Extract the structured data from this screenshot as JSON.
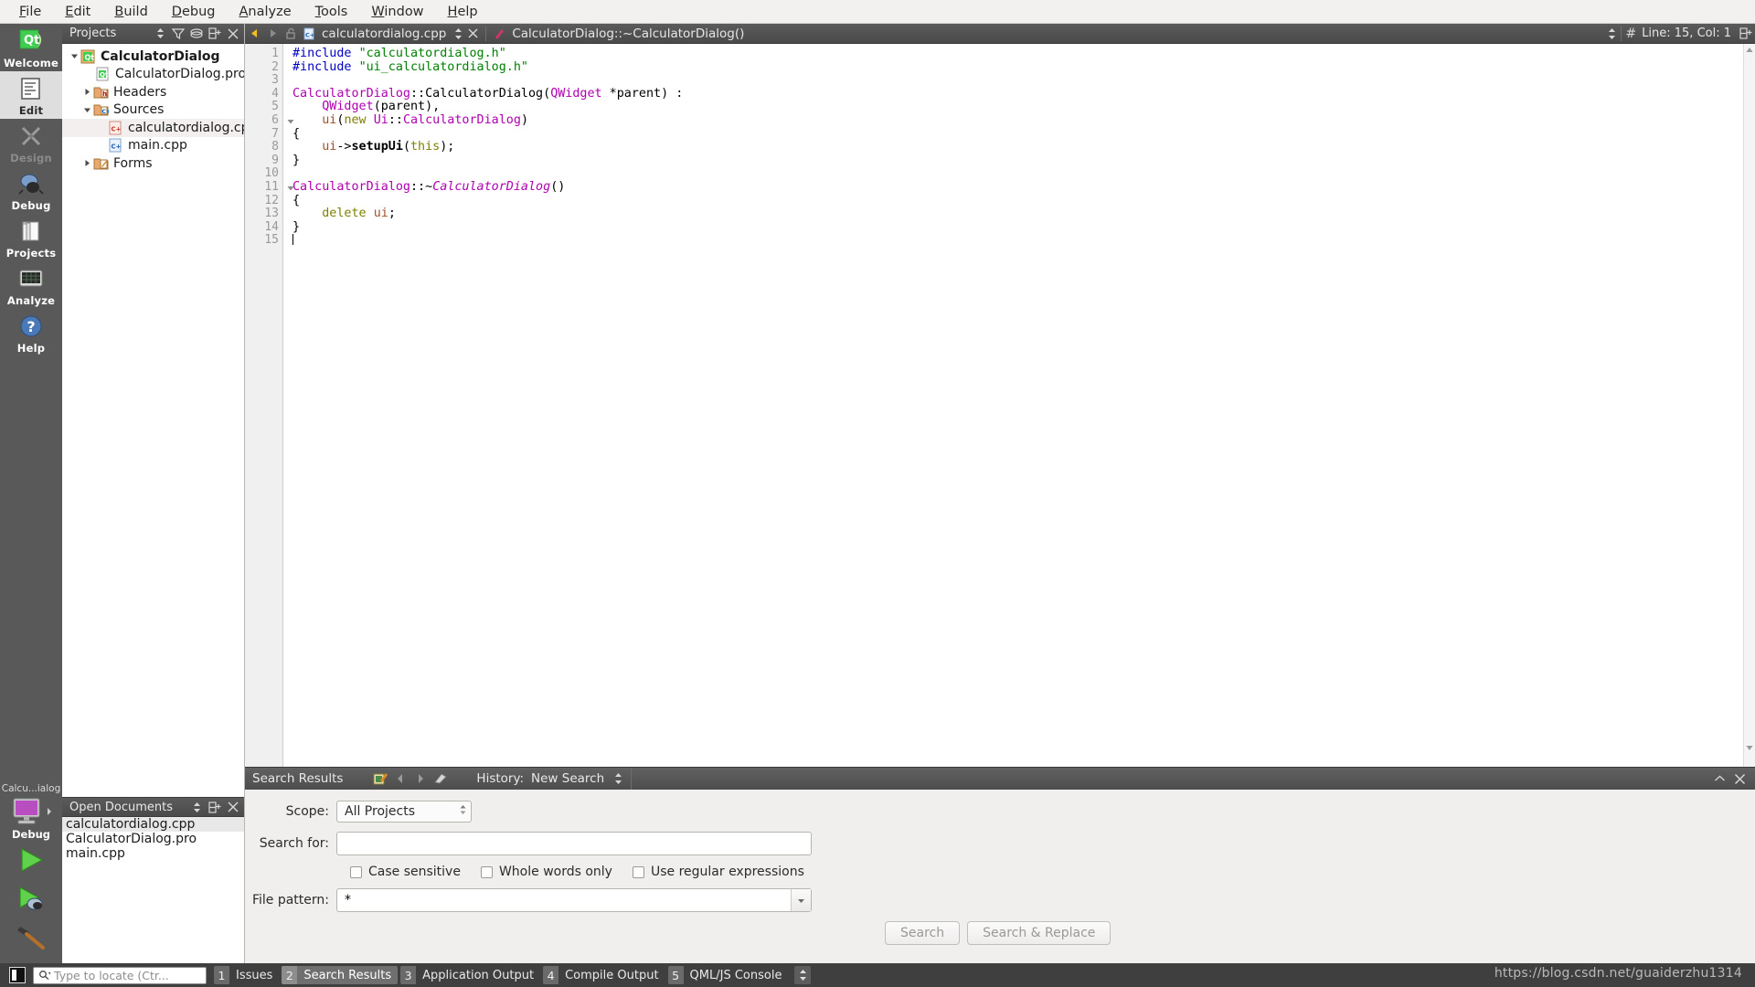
{
  "menubar": {
    "items": [
      {
        "label": "File",
        "accel": "F"
      },
      {
        "label": "Edit",
        "accel": "E"
      },
      {
        "label": "Build",
        "accel": "B"
      },
      {
        "label": "Debug",
        "accel": "D"
      },
      {
        "label": "Analyze",
        "accel": "A"
      },
      {
        "label": "Tools",
        "accel": "T"
      },
      {
        "label": "Window",
        "accel": "W"
      },
      {
        "label": "Help",
        "accel": "H"
      }
    ]
  },
  "modebar": {
    "modes": [
      {
        "label": "Welcome",
        "icon": "qt-logo-icon",
        "state": "normal"
      },
      {
        "label": "Edit",
        "icon": "document-edit-icon",
        "state": "selected"
      },
      {
        "label": "Design",
        "icon": "design-ruler-pen-icon",
        "state": "disabled"
      },
      {
        "label": "Debug",
        "icon": "bug-icon",
        "state": "normal"
      },
      {
        "label": "Projects",
        "icon": "folders-icon",
        "state": "normal"
      },
      {
        "label": "Analyze",
        "icon": "analyze-monitor-icon",
        "state": "normal"
      },
      {
        "label": "Help",
        "icon": "help-question-icon",
        "state": "normal"
      }
    ],
    "kit_hint": "Calcu...ialog",
    "run_config": "Debug",
    "run_button": "run-icon",
    "debug_button": "run-debug-icon",
    "build_button": "build-hammer-icon"
  },
  "projects_dock": {
    "title": "Projects",
    "tools": [
      "filter-icon",
      "sync-icon",
      "split-icon",
      "close-icon"
    ],
    "tree": [
      {
        "label": "CalculatorDialog",
        "indent": 0,
        "arrow": "down",
        "icon": "qt-project-icon",
        "bold": true,
        "selected": false
      },
      {
        "label": "CalculatorDialog.pro",
        "indent": 1,
        "arrow": "none",
        "icon": "qt-pro-file-icon",
        "bold": false,
        "selected": false
      },
      {
        "label": "Headers",
        "indent": 1,
        "arrow": "right",
        "icon": "folder-headers-icon",
        "bold": false,
        "selected": false
      },
      {
        "label": "Sources",
        "indent": 1,
        "arrow": "down",
        "icon": "folder-sources-icon",
        "bold": false,
        "selected": false
      },
      {
        "label": "calculatordialog.cpp",
        "indent": 2,
        "arrow": "none",
        "icon": "cpp-file-icon",
        "bold": false,
        "selected": true
      },
      {
        "label": "main.cpp",
        "indent": 2,
        "arrow": "none",
        "icon": "cpp-file-icon",
        "bold": false,
        "selected": false
      },
      {
        "label": "Forms",
        "indent": 1,
        "arrow": "right",
        "icon": "folder-forms-icon",
        "bold": false,
        "selected": false
      }
    ]
  },
  "open_documents_dock": {
    "title": "Open Documents",
    "tools": [
      "sort-icon",
      "split-icon",
      "close-icon"
    ],
    "documents": [
      {
        "name": "calculatordialog.cpp",
        "selected": true
      },
      {
        "name": "CalculatorDialog.pro",
        "selected": false
      },
      {
        "name": "main.cpp",
        "selected": false
      }
    ]
  },
  "editor_toolbar": {
    "back_icon": "arrow-back-icon",
    "forward_icon": "arrow-forward-icon",
    "lock_icon": "unlocked-icon",
    "file_icon": "cpp-file-icon",
    "filename": "calculatordialog.cpp",
    "close_icon": "close-icon",
    "symbol_icon": "symbol-marker-icon",
    "symbol": "CalculatorDialog::~CalculatorDialog()",
    "line_col_icon": "hash-icon",
    "line_col": "Line: 15, Col: 1",
    "split_icon": "split-icon"
  },
  "code": {
    "lines": [
      {
        "num": "1",
        "fold": "",
        "tokens": [
          {
            "t": "#include ",
            "c": "tk-pre"
          },
          {
            "t": "\"calculatordialog.h\"",
            "c": "tk-str"
          }
        ]
      },
      {
        "num": "2",
        "fold": "",
        "tokens": [
          {
            "t": "#include ",
            "c": "tk-pre"
          },
          {
            "t": "\"ui_calculatordialog.h\"",
            "c": "tk-str"
          }
        ]
      },
      {
        "num": "3",
        "fold": "",
        "tokens": []
      },
      {
        "num": "4",
        "fold": "",
        "tokens": [
          {
            "t": "CalculatorDialog",
            "c": "tk-type"
          },
          {
            "t": "::CalculatorDialog(",
            "c": ""
          },
          {
            "t": "QWidget",
            "c": "tk-type"
          },
          {
            "t": " *parent) :",
            "c": ""
          }
        ]
      },
      {
        "num": "5",
        "fold": "",
        "tokens": [
          {
            "t": "    ",
            "c": ""
          },
          {
            "t": "QWidget",
            "c": "tk-type"
          },
          {
            "t": "(parent),",
            "c": ""
          }
        ]
      },
      {
        "num": "6",
        "fold": "down",
        "tokens": [
          {
            "t": "    ",
            "c": ""
          },
          {
            "t": "ui",
            "c": "tk-var"
          },
          {
            "t": "(",
            "c": ""
          },
          {
            "t": "new",
            "c": "tk-kw"
          },
          {
            "t": " ",
            "c": ""
          },
          {
            "t": "Ui",
            "c": "tk-type"
          },
          {
            "t": "::",
            "c": ""
          },
          {
            "t": "CalculatorDialog",
            "c": "tk-type"
          },
          {
            "t": ")",
            "c": ""
          }
        ]
      },
      {
        "num": "7",
        "fold": "",
        "tokens": [
          {
            "t": "{",
            "c": ""
          }
        ]
      },
      {
        "num": "8",
        "fold": "",
        "tokens": [
          {
            "t": "    ",
            "c": ""
          },
          {
            "t": "ui",
            "c": "tk-var"
          },
          {
            "t": "->",
            "c": ""
          },
          {
            "t": "setupUi",
            "c": "tk-fn"
          },
          {
            "t": "(",
            "c": ""
          },
          {
            "t": "this",
            "c": "tk-kw"
          },
          {
            "t": ");",
            "c": ""
          }
        ]
      },
      {
        "num": "9",
        "fold": "",
        "tokens": [
          {
            "t": "}",
            "c": ""
          }
        ]
      },
      {
        "num": "10",
        "fold": "",
        "tokens": []
      },
      {
        "num": "11",
        "fold": "down",
        "tokens": [
          {
            "t": "CalculatorDialog",
            "c": "tk-type"
          },
          {
            "t": "::~",
            "c": ""
          },
          {
            "t": "CalculatorDialog",
            "c": "tk-type tk-italic"
          },
          {
            "t": "()",
            "c": ""
          }
        ]
      },
      {
        "num": "12",
        "fold": "",
        "tokens": [
          {
            "t": "{",
            "c": ""
          }
        ]
      },
      {
        "num": "13",
        "fold": "",
        "tokens": [
          {
            "t": "    ",
            "c": ""
          },
          {
            "t": "delete",
            "c": "tk-kw"
          },
          {
            "t": " ",
            "c": ""
          },
          {
            "t": "ui",
            "c": "tk-var"
          },
          {
            "t": ";",
            "c": ""
          }
        ]
      },
      {
        "num": "14",
        "fold": "",
        "tokens": [
          {
            "t": "}",
            "c": ""
          }
        ]
      },
      {
        "num": "15",
        "fold": "",
        "tokens": []
      }
    ]
  },
  "search_panel": {
    "title": "Search Results",
    "tools": [
      "new-search-icon",
      "prev-result-icon",
      "next-result-icon",
      "clear-results-icon"
    ],
    "history_label": "History:",
    "history_value": "New Search",
    "minimize_icon": "chevron-up-icon",
    "close_icon": "close-icon",
    "scope_label": "Scope:",
    "scope_value": "All Projects",
    "search_for_label": "Search for:",
    "search_for_value": "",
    "search_for_placeholder": "",
    "checkboxes": [
      {
        "label": "Case sensitive",
        "checked": false
      },
      {
        "label": "Whole words only",
        "checked": false
      },
      {
        "label": "Use regular expressions",
        "checked": false
      }
    ],
    "file_pattern_label": "File pattern:",
    "file_pattern_value": "*",
    "search_button": "Search",
    "search_replace_button": "Search & Replace"
  },
  "statusbar": {
    "toggle_sidebar_icon": "sidebar-toggle-icon",
    "locator_icon": "search-icon",
    "locator_placeholder": "Type to locate (Ctr...",
    "output_tabs": [
      {
        "num": "1",
        "label": "Issues",
        "active": false
      },
      {
        "num": "2",
        "label": "Search Results",
        "active": true
      },
      {
        "num": "3",
        "label": "Application Output",
        "active": false
      },
      {
        "num": "4",
        "label": "Compile Output",
        "active": false
      },
      {
        "num": "5",
        "label": "QML/JS Console",
        "active": false
      }
    ],
    "spin_icon": "updown-spin-icon",
    "watermark": "https://blog.csdn.net/guaiderzhu1314"
  },
  "colors": {
    "mode_bar_bg": "#595959",
    "dock_header_bg": "#4f4f4f",
    "status_bar_bg": "#3f3f3f",
    "panel_bg": "#f0efee",
    "selection_bg": "#e8e8e8",
    "string_green": "#008000",
    "preproc_blue": "#0000c0",
    "type_magenta": "#b000b0",
    "keyword_olive": "#808000",
    "var_brown": "#a0522d"
  }
}
